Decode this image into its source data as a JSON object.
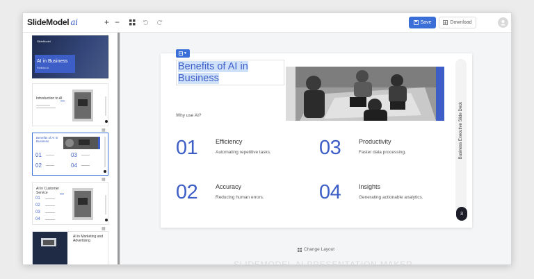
{
  "app": {
    "logo_text": "SlideModel",
    "logo_suffix": "ai"
  },
  "toolbar": {
    "plus_label": "+",
    "minus_label": "−",
    "save_label": "Save",
    "download_label": "Download",
    "icons": {
      "layout": "grid-icon",
      "undo": "undo-icon",
      "redo": "redo-icon",
      "save": "save-icon",
      "download": "download-icon",
      "avatar": "user-icon"
    }
  },
  "sidebar": {
    "thumbnails": [
      {
        "title": "AI in Business",
        "kicker": "SlideModel",
        "subtitle": "Portfolio AI",
        "layout": "cover"
      },
      {
        "title": "Introduction to AI",
        "layout": "intro"
      },
      {
        "title": "Benefits of AI in Business",
        "layout": "benefits",
        "selected": true
      },
      {
        "title": "AI in Customer Service",
        "layout": "list"
      },
      {
        "title": "AI in Marketing and Advertising",
        "layout": "marketing"
      }
    ]
  },
  "slide": {
    "title": "Benefits of AI in Business",
    "subtitle": "Why use AI?",
    "side_label": "Business Executive Slide Deck",
    "page_number": "3",
    "items": [
      {
        "number": "01",
        "heading": "Efficiency",
        "description": "Automating repetitive tasks."
      },
      {
        "number": "03",
        "heading": "Productivity",
        "description": "Faster data processing."
      },
      {
        "number": "02",
        "heading": "Accuracy",
        "description": "Reducing human errors."
      },
      {
        "number": "04",
        "heading": "Insights",
        "description": "Generating actionable analytics."
      }
    ]
  },
  "footer": {
    "change_layout_label": "Change Layout",
    "watermark": "SLIDEMODEL AI PRESENTATION MAKER"
  },
  "colors": {
    "accent": "#3d5ec6",
    "save_button": "#3a6fd8",
    "highlight": "#cfe0fb"
  }
}
